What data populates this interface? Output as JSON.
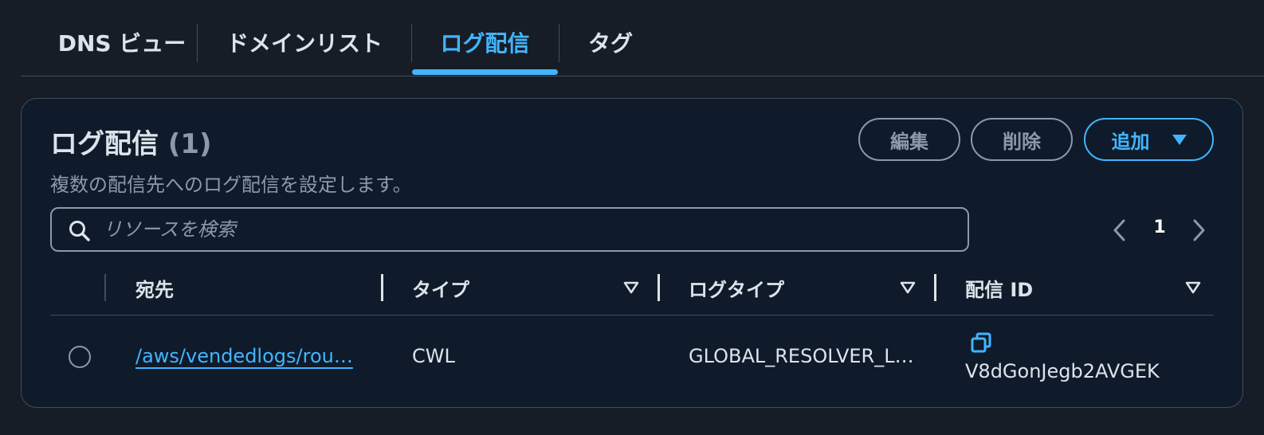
{
  "tabs": [
    {
      "label": "DNS ビュー",
      "active": false
    },
    {
      "label": "ドメインリスト",
      "active": false
    },
    {
      "label": "ログ配信",
      "active": true
    },
    {
      "label": "タグ",
      "active": false
    }
  ],
  "panel": {
    "title": "ログ配信",
    "count": "(1)",
    "description": "複数の配信先へのログ配信を設定します。",
    "buttons": {
      "edit": "編集",
      "delete": "削除",
      "add": "追加"
    }
  },
  "search": {
    "placeholder": "リソースを検索",
    "value": ""
  },
  "pagination": {
    "page": "1"
  },
  "table": {
    "columns": [
      "宛先",
      "タイプ",
      "ログタイプ",
      "配信 ID"
    ],
    "rows": [
      {
        "destination": "/aws/vendedlogs/rou…",
        "type": "CWL",
        "log_type": "GLOBAL_RESOLVER_L…",
        "delivery_id": "V8dGonJegb2AVGEK"
      }
    ]
  },
  "colors": {
    "accent": "#42b4ff",
    "background": "#161d26",
    "panel": "#0f1b2a",
    "muted": "#8d99a8",
    "border": "#414d5c"
  },
  "icons": [
    "search-icon",
    "chevron-left-icon",
    "chevron-right-icon",
    "caret-down-icon",
    "sort-icon",
    "copy-icon"
  ]
}
